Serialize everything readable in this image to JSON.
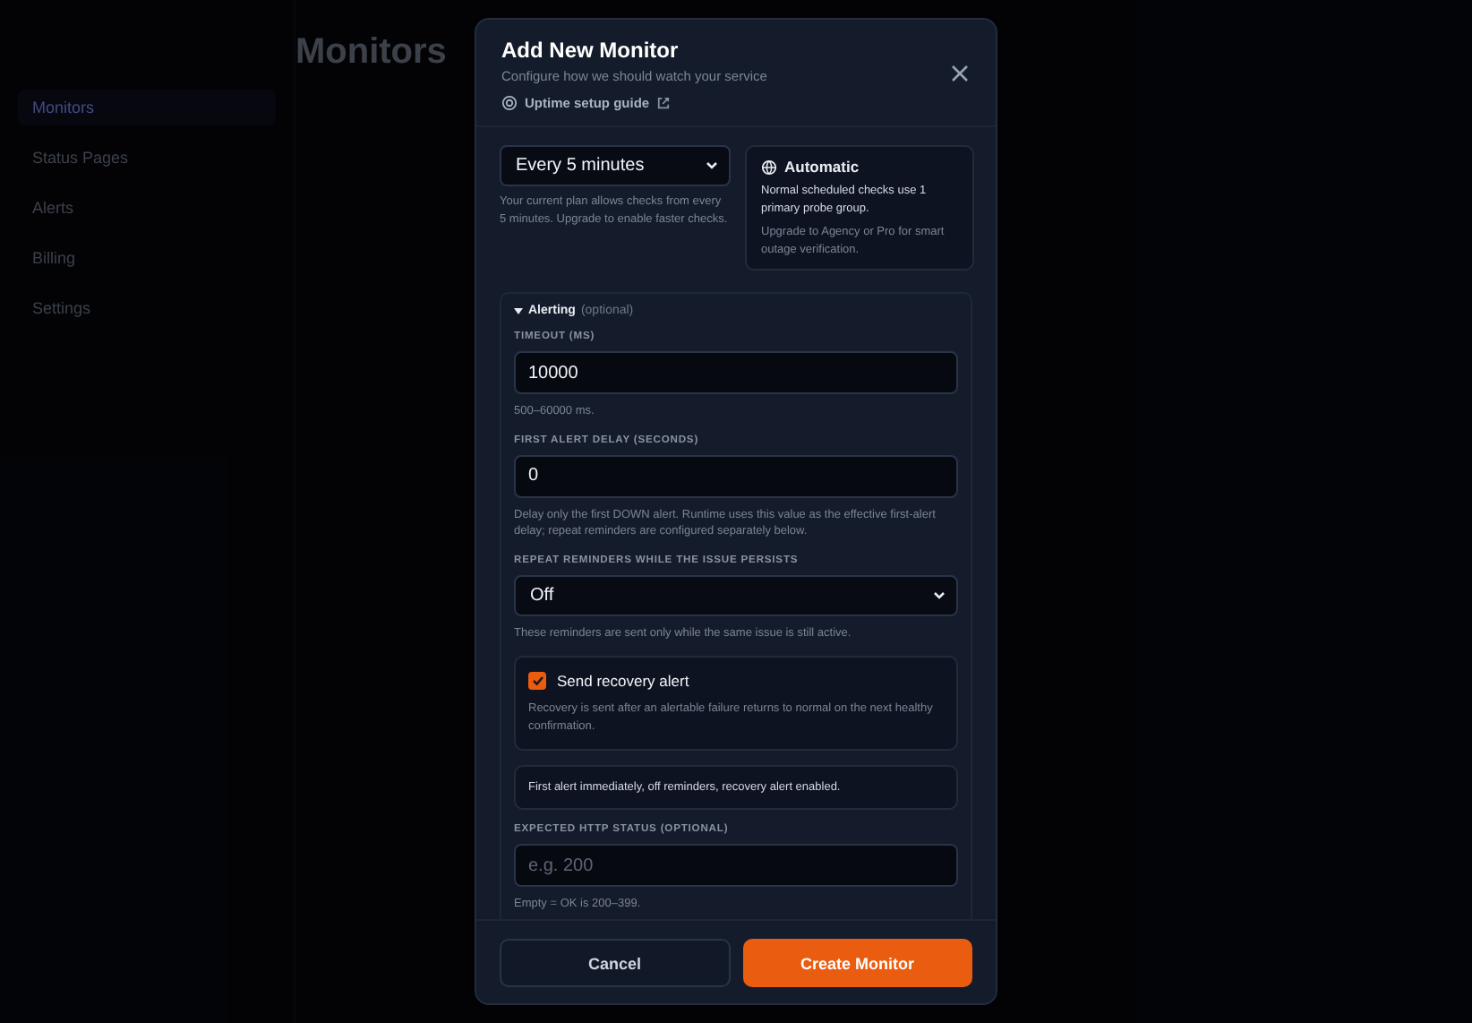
{
  "background": {
    "page_title": "Monitors",
    "sidebar_items": [
      {
        "label": "Monitors",
        "selected": true
      },
      {
        "label": "Status Pages",
        "selected": false
      },
      {
        "label": "Alerts",
        "selected": false
      },
      {
        "label": "Billing",
        "selected": false
      },
      {
        "label": "Settings",
        "selected": false
      }
    ]
  },
  "modal": {
    "title": "Add New Monitor",
    "subtitle": "Configure how we should watch your service",
    "guide_link": "Uptime setup guide",
    "interval": {
      "value": "Every 5 minutes",
      "hint": "Your current plan allows checks from every 5 minutes. Upgrade to enable faster checks."
    },
    "probe": {
      "title": "Automatic",
      "text": "Normal scheduled checks use 1 primary probe group.",
      "upgrade": "Upgrade to Agency or Pro for smart outage verification."
    },
    "alerting": {
      "title": "Alerting",
      "note": "(optional)",
      "expanded": true,
      "items": [
        {
          "kind": "input",
          "label": "TIMEOUT (MS)",
          "value": "10000",
          "hint": "500–60000 ms."
        },
        {
          "kind": "input",
          "label": "FIRST ALERT DELAY (SECONDS)",
          "value": "0",
          "hint": "Delay only the first DOWN alert. Runtime uses this value as the effective first-alert delay; repeat reminders are configured separately below."
        },
        {
          "kind": "select",
          "label": "REPEAT REMINDERS WHILE THE ISSUE PERSISTS",
          "value": "Off",
          "hint": "These reminders are sent only while the same issue is still active."
        },
        {
          "kind": "checkbox",
          "label": "Send recovery alert",
          "checked": true,
          "hint": "Recovery is sent after an alertable failure returns to normal on the next healthy confirmation."
        },
        {
          "kind": "summary",
          "text": "First alert immediately, off reminders, recovery alert enabled."
        },
        {
          "kind": "input",
          "label": "EXPECTED HTTP STATUS (OPTIONAL)",
          "placeholder": "e.g. 200",
          "hint": "Empty = OK is 200–399."
        }
      ]
    },
    "buttons": {
      "cancel": "Cancel",
      "submit": "Create Monitor"
    }
  }
}
